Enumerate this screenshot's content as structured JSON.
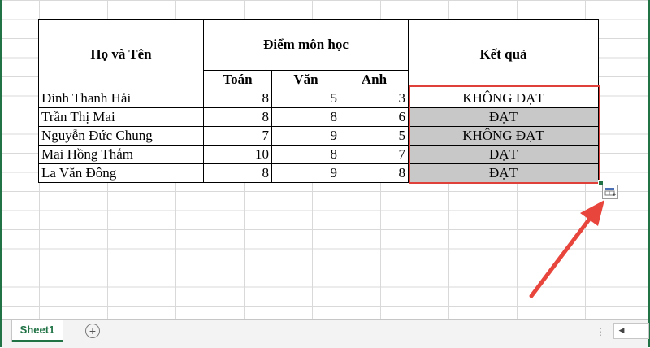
{
  "headers": {
    "name": "Họ và Tên",
    "scores_group": "Điểm môn học",
    "result": "Kết quả",
    "subjects": [
      "Toán",
      "Văn",
      "Anh"
    ]
  },
  "rows": [
    {
      "name": "Đinh Thanh Hải",
      "toan": "8",
      "van": "5",
      "anh": "3",
      "result": "KHÔNG ĐẠT"
    },
    {
      "name": "Trần Thị Mai",
      "toan": "8",
      "van": "8",
      "anh": "6",
      "result": "ĐẠT"
    },
    {
      "name": "Nguyễn Đức Chung",
      "toan": "7",
      "van": "9",
      "anh": "5",
      "result": "KHÔNG ĐẠT"
    },
    {
      "name": "Mai Hồng Thắm",
      "toan": "10",
      "van": "8",
      "anh": "7",
      "result": "ĐẠT"
    },
    {
      "name": "La Văn Đông",
      "toan": "8",
      "van": "9",
      "anh": "8",
      "result": "ĐẠT"
    }
  ],
  "sheet_tab": "Sheet1",
  "add_sheet_symbol": "+",
  "scroll_dots": "⋮",
  "scroll_left_symbol": "◀",
  "colors": {
    "excel_green": "#217346",
    "selection_red": "#e0403a",
    "selected_fill": "#c8c8c8",
    "arrow_red": "#e8453c"
  },
  "icons": {
    "quick_analysis": "quick-analysis-icon",
    "annotation_arrow": "arrow-icon"
  }
}
